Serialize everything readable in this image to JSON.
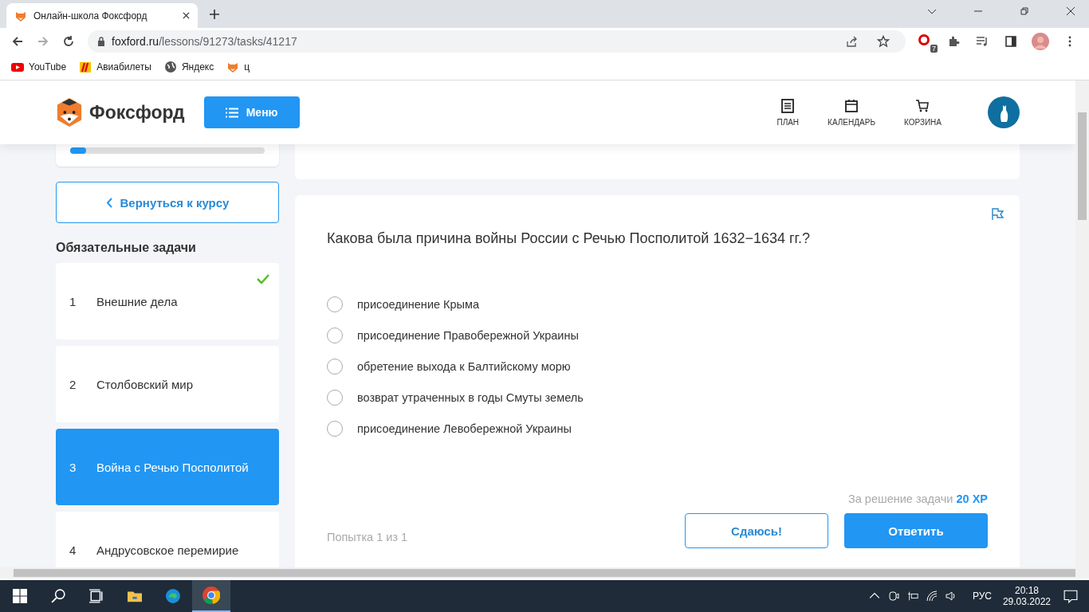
{
  "browser": {
    "tab_title": "Онлайн-школа Фоксфорд",
    "url_host": "foxford.ru",
    "url_path": "/lessons/91273/tasks/41217",
    "extension_badge": "7",
    "bookmarks": [
      {
        "label": "YouTube",
        "kind": "youtube"
      },
      {
        "label": "Авиабилеты",
        "kind": "tickets"
      },
      {
        "label": "Яндекс",
        "kind": "globe"
      },
      {
        "label": "ц",
        "kind": "fox"
      }
    ]
  },
  "header": {
    "logo": "Фоксфорд",
    "menu": "Меню",
    "nav": [
      {
        "label": "ПЛАН",
        "kind": "plan"
      },
      {
        "label": "КАЛЕНДАРЬ",
        "kind": "calendar"
      },
      {
        "label": "КОРЗИНА",
        "kind": "cart"
      }
    ]
  },
  "sidebar": {
    "progress": {
      "level": 0.08
    },
    "back": "Вернуться к курсу",
    "heading": "Обязательные задачи",
    "tasks": [
      {
        "number": "1",
        "title": "Внешние дела",
        "done": true,
        "selected": false
      },
      {
        "number": "2",
        "title": "Столбовский мир",
        "done": false,
        "selected": false
      },
      {
        "number": "3",
        "title": "Война с Речью Посполитой",
        "done": false,
        "selected": true
      },
      {
        "number": "4",
        "title": "Андрусовское перемирие",
        "done": false,
        "selected": false
      }
    ]
  },
  "question": {
    "text": "Какова была причина войны России с Речью Посполитой 1632−1634 гг.?",
    "options": [
      {
        "label": "присоединение Крыма",
        "selected": false
      },
      {
        "label": "присоединение Правобережной Украины",
        "selected": false
      },
      {
        "label": "обретение выхода к Балтийскому морю",
        "selected": false
      },
      {
        "label": "возврат утраченных в годы Смуты земель",
        "selected": false
      },
      {
        "label": "присоединение Левобережной Украины",
        "selected": false
      }
    ],
    "reward_label": "За решение задачи",
    "reward_value": "20 XP",
    "attempt": "Попытка 1 из 1",
    "give_up": "Сдаюсь!",
    "answer": "Ответить"
  },
  "taskbar": {
    "language": "РУС",
    "time": "20:18",
    "date": "29.03.2022"
  }
}
